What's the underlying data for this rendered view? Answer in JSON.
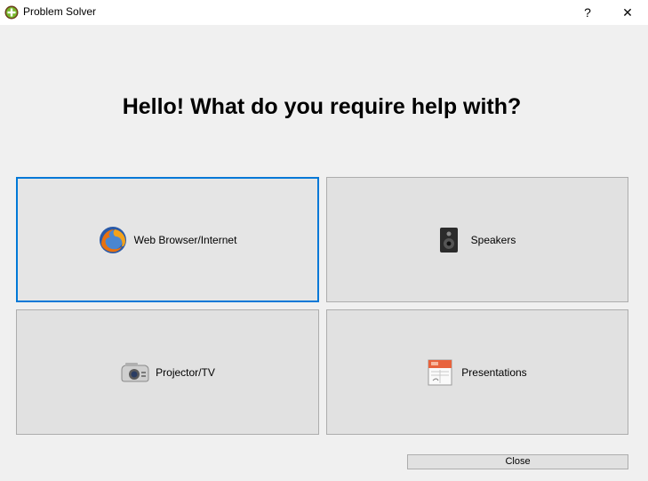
{
  "window": {
    "title": "Problem Solver",
    "app_icon": "green-plus-icon",
    "help_label": "?",
    "close_glyph": "✕"
  },
  "heading": "Hello! What do you require help with?",
  "options": [
    {
      "label": "Web Browser/Internet",
      "icon": "firefox-icon",
      "focused": true
    },
    {
      "label": "Speakers",
      "icon": "speaker-icon",
      "focused": false
    },
    {
      "label": "Projector/TV",
      "icon": "projector-icon",
      "focused": false
    },
    {
      "label": "Presentations",
      "icon": "presentation-icon",
      "focused": false
    }
  ],
  "footer": {
    "close_label": "Close"
  },
  "colors": {
    "focus_border": "#0078d7",
    "tile_bg": "#e1e1e1",
    "window_bg": "#f0f0f0"
  }
}
